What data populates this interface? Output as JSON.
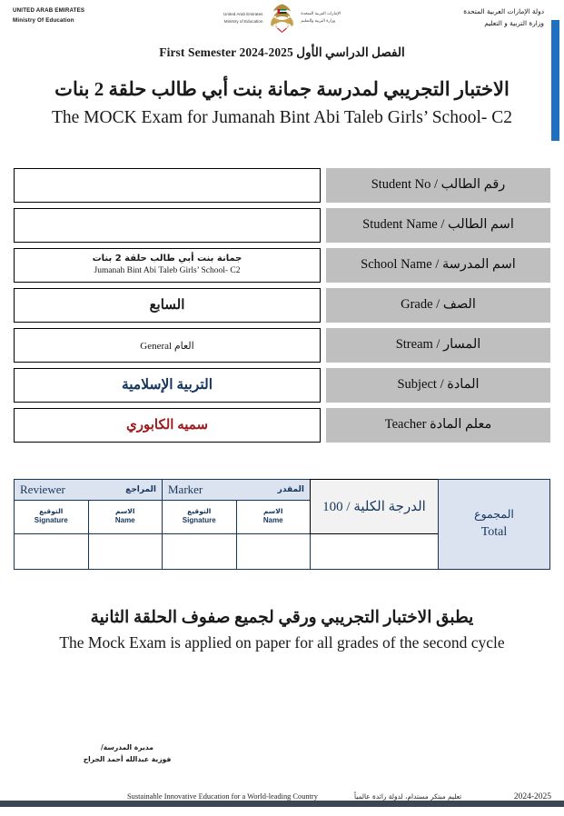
{
  "header": {
    "left_line1": "UNITED ARAB EMIRATES",
    "left_line2": "Ministry Of Education",
    "right_line1": "دولة الإمارات العربية المتحدة",
    "right_line2": "وزارة التربية و التعليم",
    "center_en_line1": "United Arab Emirates",
    "center_en_line2": "Ministry of Education",
    "center_ar_line1": "الإمارات العربية المتحدة",
    "center_ar_line2": "وزارة التربية والتعليم",
    "emblem_name": "uae-ministry-of-education-falcon-emblem",
    "accent_color": "#1f70c1"
  },
  "titles": {
    "semester_ar": "الفصل الدراسي الأول",
    "semester_en": "First Semester 2024-2025",
    "exam_title_ar": "الاختبار التجريبي لمدرسة جمانة بنت أبي طالب حلقة 2 بنات",
    "exam_title_en": "The MOCK Exam for Jumanah Bint Abi Taleb Girls’ School- C2"
  },
  "info_rows": [
    {
      "label_ar": "رقم الطالب",
      "label_en": "Student No",
      "label_combined": "رقم الطالب / Student No",
      "value_ar": "",
      "value_en": "",
      "name": "student-no"
    },
    {
      "label_ar": "اسم الطالب",
      "label_en": "Student Name",
      "label_combined": "اسم الطالب / Student Name",
      "value_ar": "",
      "value_en": "",
      "name": "student-name"
    },
    {
      "label_ar": "اسم المدرسة",
      "label_en": "School Name",
      "label_combined": "اسم المدرسة / School Name",
      "value_ar": "جمانة بنت أبي طالب حلقة 2 بنات",
      "value_en": "Jumanah Bint Abi Taleb Girls’ School- C2",
      "name": "school-name"
    },
    {
      "label_ar": "الصف",
      "label_en": "Grade",
      "label_combined": "الصف / Grade",
      "value_ar": "السابع",
      "value_en": "",
      "name": "grade"
    },
    {
      "label_ar": "المسار",
      "label_en": "Stream",
      "label_combined": "المسار / Stream",
      "value_ar": "العام General",
      "value_en": "",
      "name": "stream"
    },
    {
      "label_ar": "المادة",
      "label_en": "Subject",
      "label_combined": "المادة / Subject",
      "value_ar": "التربية الإسلامية",
      "value_en": "",
      "name": "subject"
    },
    {
      "label_ar": "معلم المادة",
      "label_en": "Teacher",
      "label_combined": "معلم المادة Teacher",
      "value_ar": "سميه الكابوري",
      "value_en": "",
      "name": "teacher"
    }
  ],
  "info_colors": {
    "label_bg": "#bfbfbf",
    "subject_text": "#17365d",
    "teacher_text": "#9e1b20"
  },
  "grading": {
    "total_ar": "المجموع",
    "total_en": "Total",
    "score_text": "الدرجة الكلية / 100",
    "score_max": "100",
    "marker_ar": "المقدر",
    "marker_en": "Marker",
    "reviewer_ar": "المراجع",
    "reviewer_en": "Reviewer",
    "name_ar": "الاسم",
    "name_en": "Name",
    "signature_ar": "التوقيع",
    "signature_en": "Signature",
    "header_bg": "#dbe3f1",
    "score_bg": "#f2f2f2",
    "border_color": "#17365d"
  },
  "notes": {
    "ar": "يطبق الاختبار التجريبي ورقي لجميع صفوف الحلقة الثانية",
    "en": "The Mock Exam is applied on paper for all grades of the second cycle"
  },
  "signature": {
    "role": "مديرة المدرسة/",
    "name": "فوزية عبدالله أحمد الجراح"
  },
  "footer": {
    "slogan_en": "Sustainable Innovative Education for a World-leading Country",
    "slogan_ar": "تعليم مبتكر مستدام، لدولة رائدة عالمياً",
    "year": "2024-2025",
    "bar_color": "#3d4753"
  }
}
